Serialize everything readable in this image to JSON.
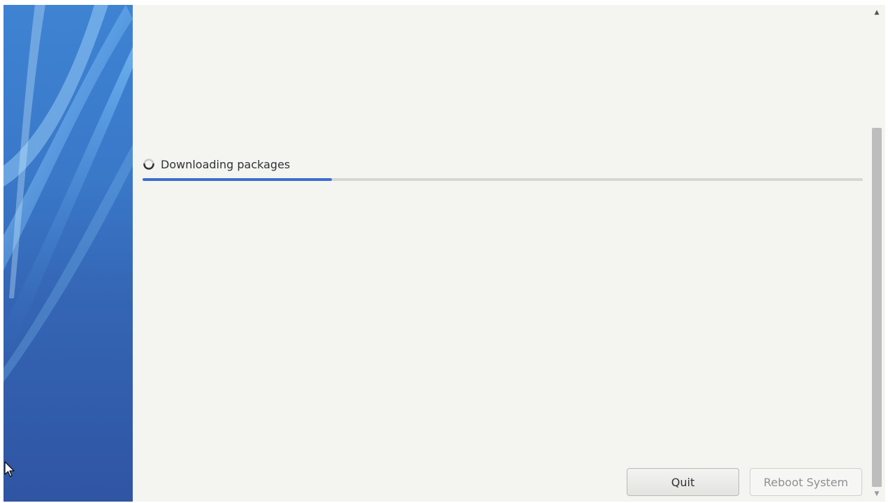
{
  "installer": {
    "status_text": "Downloading packages",
    "progress_fraction": 0.263,
    "progress_color": "#3a6fd1"
  },
  "buttons": {
    "quit_label": "Quit",
    "reboot_label": "Reboot System"
  },
  "scrollbar": {
    "up_arrow": "▲",
    "down_arrow": "▼"
  },
  "icons": {
    "status": "spinner-icon",
    "pointer": "mouse-cursor-icon"
  }
}
